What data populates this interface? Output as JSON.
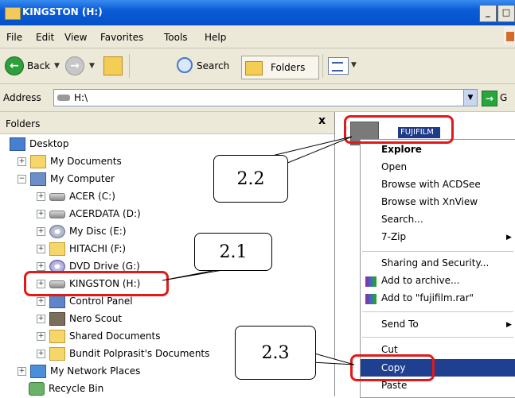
{
  "window": {
    "title": "KINGSTON (H:)",
    "controls": [
      "_",
      "□"
    ]
  },
  "menu": [
    "File",
    "Edit",
    "View",
    "Favorites",
    "Tools",
    "Help"
  ],
  "toolbar": {
    "back": "Back",
    "search": "Search",
    "folders": "Folders"
  },
  "address": {
    "label": "Address",
    "value": "H:\\",
    "go": "G"
  },
  "folders_pane": {
    "title": "Folders",
    "close": "x",
    "items": [
      {
        "label": "Desktop",
        "expander": "",
        "icon": "desktop-icon"
      },
      {
        "label": "My Documents",
        "expander": "+",
        "icon": "documents-icon"
      },
      {
        "label": "My Computer",
        "expander": "−",
        "icon": "computer-icon"
      },
      {
        "label": "ACER (C:)",
        "expander": "+",
        "icon": "drive-icon"
      },
      {
        "label": "ACERDATA (D:)",
        "expander": "+",
        "icon": "drive-icon"
      },
      {
        "label": "My Disc (E:)",
        "expander": "+",
        "icon": "disc-icon"
      },
      {
        "label": "HITACHI (F:)",
        "expander": "+",
        "icon": "folder-icon"
      },
      {
        "label": "DVD Drive (G:)",
        "expander": "+",
        "icon": "dvd-icon"
      },
      {
        "label": "KINGSTON (H:)",
        "expander": "+",
        "icon": "drive-icon"
      },
      {
        "label": "Control Panel",
        "expander": "+",
        "icon": "control-panel-icon"
      },
      {
        "label": "Nero Scout",
        "expander": "+",
        "icon": "nero-icon"
      },
      {
        "label": "Shared Documents",
        "expander": "+",
        "icon": "folder-icon"
      },
      {
        "label": "Bundit Polprasit's Documents",
        "expander": "+",
        "icon": "folder-icon"
      },
      {
        "label": "My Network Places",
        "expander": "+",
        "icon": "network-icon"
      },
      {
        "label": "Recycle Bin",
        "expander": "",
        "icon": "recycle-bin-icon"
      }
    ]
  },
  "content": {
    "selected_folder_name": "FUJIFILM"
  },
  "context_menu": {
    "items": [
      {
        "label": "Explore"
      },
      {
        "label": "Open"
      },
      {
        "label": "Browse with ACDSee"
      },
      {
        "label": "Browse with XnView"
      },
      {
        "label": "Search..."
      },
      {
        "label": "7-Zip",
        "submenu": true
      },
      {
        "label": "Sharing and Security..."
      },
      {
        "label": "Add to archive..."
      },
      {
        "label": "Add to \"fujifilm.rar\""
      },
      {
        "label": "Send To",
        "submenu": true
      },
      {
        "label": "Cut"
      },
      {
        "label": "Copy"
      },
      {
        "label": "Paste"
      }
    ]
  },
  "callouts": {
    "c21": "2.1",
    "c22": "2.2",
    "c23": "2.3"
  },
  "colors": {
    "title_bar": "#0a5cd6",
    "highlight": "#1f3f90",
    "annotation_ring": "#e01a1a"
  }
}
